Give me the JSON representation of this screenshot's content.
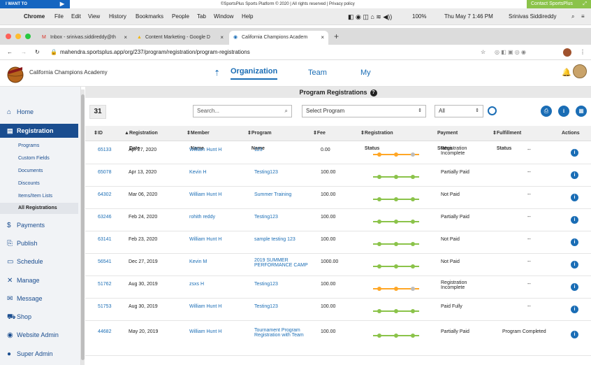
{
  "banner": {
    "iwant_label": "I WANT TO",
    "center_text": "©SportsPlus Sports Platform © 2020 | All rights reserved | Privacy policy",
    "contact_label": "Contact SportsPlus"
  },
  "macmenu": {
    "app": "Chrome",
    "items": [
      "File",
      "Edit",
      "View",
      "History",
      "Bookmarks",
      "People",
      "Tab",
      "Window",
      "Help"
    ],
    "battery": "100%",
    "datetime": "Thu May 7  1:46 PM",
    "user": "Srinivas Siddireddy"
  },
  "browser": {
    "tabs": [
      {
        "label": "Inbox - srinivas.siddireddy@th",
        "icon": "gmail-icon"
      },
      {
        "label": "Content Marketing - Google D",
        "icon": "drive-icon"
      },
      {
        "label": "California Champions Academ",
        "icon": "sportsplus-icon"
      }
    ],
    "url": "mahendra.sportsplus.app/org/237/program/registration/program-registrations"
  },
  "app": {
    "academy_name": "California Champions Academy",
    "nav": [
      "Organization",
      "Team",
      "My"
    ]
  },
  "sidebar": {
    "items": [
      {
        "label": "Home",
        "icon": "⌂"
      },
      {
        "label": "Registration",
        "icon": "▤"
      },
      {
        "label": "Payments",
        "icon": "$"
      },
      {
        "label": "Publish",
        "icon": "⎘"
      },
      {
        "label": "Schedule",
        "icon": "▭"
      },
      {
        "label": "Manage",
        "icon": "✕"
      },
      {
        "label": "Message",
        "icon": "✉"
      },
      {
        "label": "Shop",
        "icon": "🛒"
      },
      {
        "label": "Website Admin",
        "icon": "◉"
      },
      {
        "label": "Super Admin",
        "icon": "●"
      }
    ],
    "subitems": [
      "Programs",
      "Custom Fields",
      "Documents",
      "Discounts",
      "Items/Item Lists",
      "All Registrations"
    ]
  },
  "page": {
    "title": "Program Registrations",
    "count": "31",
    "search_placeholder": "Search...",
    "program_select": "Select Program",
    "status_select": "All"
  },
  "table": {
    "headers": [
      "ID",
      "Registration Date",
      "Member Name",
      "Program Name",
      "Fee",
      "Registration Status",
      "Payment Status",
      "Fulfillment Status",
      "Actions"
    ],
    "rows": [
      {
        "id": "65133",
        "date": "Apr 27, 2020",
        "member": "William Hunt H",
        "program": "123",
        "fee": "0.00",
        "payment": "Registration Incomplete",
        "fulfillment": "--",
        "reg_progress": "partial"
      },
      {
        "id": "65078",
        "date": "Apr 13, 2020",
        "member": "Kevin H",
        "program": "Testing123",
        "fee": "100.00",
        "payment": "Partially Paid",
        "fulfillment": "--",
        "reg_progress": "complete"
      },
      {
        "id": "64302",
        "date": "Mar 06, 2020",
        "member": "William Hunt H",
        "program": "Summer Training",
        "fee": "100.00",
        "payment": "Not Paid",
        "fulfillment": "--",
        "reg_progress": "complete"
      },
      {
        "id": "63246",
        "date": "Feb 24, 2020",
        "member": "rohith reddy",
        "program": "Testing123",
        "fee": "100.00",
        "payment": "Partially Paid",
        "fulfillment": "--",
        "reg_progress": "complete"
      },
      {
        "id": "63141",
        "date": "Feb 23, 2020",
        "member": "William Hunt H",
        "program": "sample testing 123",
        "fee": "100.00",
        "payment": "Not Paid",
        "fulfillment": "--",
        "reg_progress": "complete"
      },
      {
        "id": "56541",
        "date": "Dec 27, 2019",
        "member": "Kevin M",
        "program": "2019 SUMMER PERFORMANCE CAMP",
        "fee": "1000.00",
        "payment": "Not Paid",
        "fulfillment": "--",
        "reg_progress": "complete"
      },
      {
        "id": "51762",
        "date": "Aug 30, 2019",
        "member": "zsxs H",
        "program": "Testing123",
        "fee": "100.00",
        "payment": "Registration Incomplete",
        "fulfillment": "--",
        "reg_progress": "partial"
      },
      {
        "id": "51753",
        "date": "Aug 30, 2019",
        "member": "William Hunt H",
        "program": "Testing123",
        "fee": "100.00",
        "payment": "Paid Fully",
        "fulfillment": "--",
        "reg_progress": "complete"
      },
      {
        "id": "44682",
        "date": "May 20, 2019",
        "member": "William Hunt H",
        "program": "Tournament Program Registration with Team",
        "fee": "100.00",
        "payment": "Partially Paid",
        "fulfillment": "Program Completed",
        "reg_progress": "complete"
      }
    ]
  },
  "colors": {
    "brand_blue": "#1a6db5",
    "sidebar_active": "#1a4d8f",
    "progress_green": "#8bc34a",
    "progress_orange": "#ffa726",
    "progress_grey": "#bdbdbd",
    "contact_green": "#8bc34a"
  }
}
